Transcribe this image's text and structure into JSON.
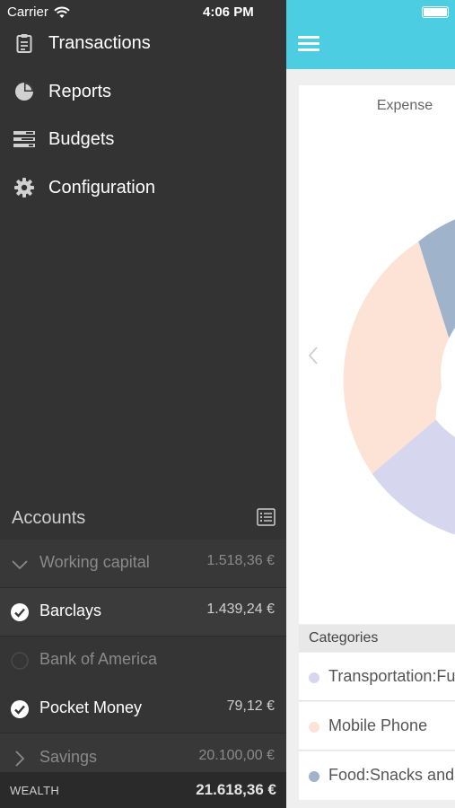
{
  "status_bar": {
    "carrier": "Carrier",
    "time": "4:06 PM"
  },
  "menu": [
    {
      "label": "Transactions",
      "icon": "clipboard-icon"
    },
    {
      "label": "Reports",
      "icon": "pie-chart-icon"
    },
    {
      "label": "Budgets",
      "icon": "budget-icon"
    },
    {
      "label": "Configuration",
      "icon": "gear-icon"
    }
  ],
  "accounts": {
    "title": "Accounts",
    "items": [
      {
        "name": "Working capital",
        "value": "1.518,36 €",
        "kind": "group-expanded"
      },
      {
        "name": "Barclays",
        "value": "1.439,24 €",
        "kind": "checked"
      },
      {
        "name": "Bank of America",
        "value": "",
        "kind": "unchecked"
      },
      {
        "name": "Pocket Money",
        "value": "79,12 €",
        "kind": "checked"
      },
      {
        "name": "Savings",
        "value": "20.100,00 €",
        "kind": "group-collapsed"
      }
    ],
    "wealth_label": "WEALTH",
    "wealth_value": "21.618,36 €"
  },
  "main": {
    "chart_title": "Expense",
    "categories_header": "Categories",
    "categories": [
      {
        "label": "Transportation:Fu",
        "color": "#d6d6ee"
      },
      {
        "label": "Mobile Phone",
        "color": "#fde3d6"
      },
      {
        "label": "Food:Snacks and",
        "color": "#9fb3cb"
      }
    ]
  },
  "colors": {
    "accent": "#4dcde2",
    "drawer_bg": "#333333",
    "donut_peach": "#fde3d6",
    "donut_lavender": "#d6d6ee",
    "donut_blue": "#9fb3cb"
  }
}
